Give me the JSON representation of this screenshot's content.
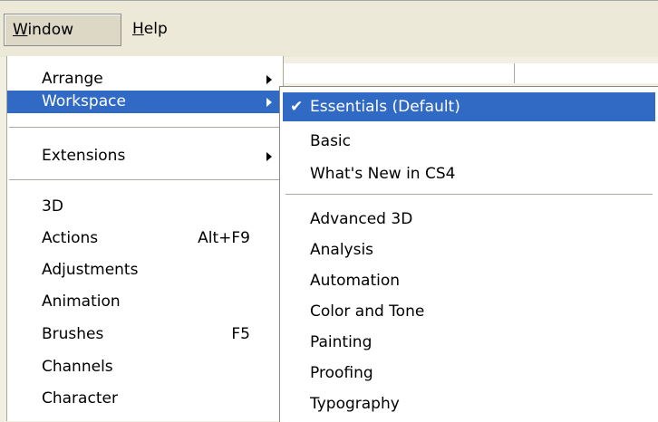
{
  "menubar": {
    "window": {
      "ul": "W",
      "rest": "indow"
    },
    "help": {
      "ul": "H",
      "rest": "elp"
    }
  },
  "window_menu": {
    "items": [
      {
        "label": "Arrange"
      },
      {
        "label": "Workspace"
      },
      {
        "label": "Extensions"
      },
      {
        "label": "3D"
      },
      {
        "label": "Actions",
        "shortcut": "Alt+F9"
      },
      {
        "label": "Adjustments"
      },
      {
        "label": "Animation"
      },
      {
        "label": "Brushes",
        "shortcut": "F5"
      },
      {
        "label": "Channels"
      },
      {
        "label": "Character"
      }
    ]
  },
  "workspace_menu": {
    "items": [
      {
        "label": "Essentials (Default)"
      },
      {
        "label": "Basic"
      },
      {
        "label": "What's New in CS4"
      },
      {
        "label": "Advanced 3D"
      },
      {
        "label": "Analysis"
      },
      {
        "label": "Automation"
      },
      {
        "label": "Color and Tone"
      },
      {
        "label": "Painting"
      },
      {
        "label": "Proofing"
      },
      {
        "label": "Typography"
      }
    ],
    "check_icon": "✔"
  },
  "colors": {
    "highlight": "#316ac5",
    "menubar": "#ece9d8"
  }
}
